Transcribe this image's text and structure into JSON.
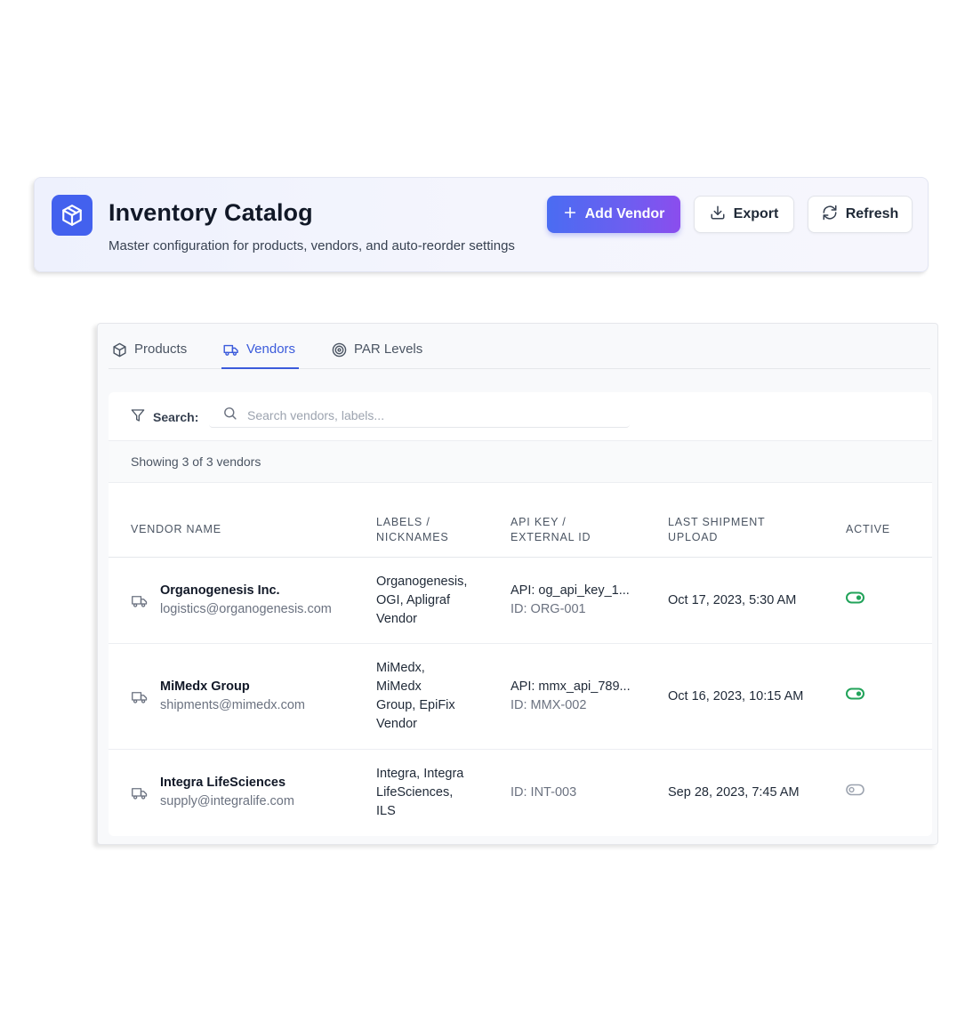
{
  "header": {
    "title": "Inventory Catalog",
    "subtitle": "Master configuration for products, vendors, and auto-reorder settings",
    "buttons": {
      "add_vendor": "Add Vendor",
      "export": "Export",
      "refresh": "Refresh"
    }
  },
  "tabs": [
    {
      "label": "Products",
      "icon": "box-icon",
      "active": false
    },
    {
      "label": "Vendors",
      "icon": "truck-icon",
      "active": true
    },
    {
      "label": "PAR Levels",
      "icon": "target-icon",
      "active": false
    }
  ],
  "filter": {
    "label": "Search:",
    "placeholder": "Search vendors, labels...",
    "value": ""
  },
  "summary": "Showing 3 of 3 vendors",
  "table": {
    "columns": {
      "vendor_name": "VENDOR NAME",
      "labels_1": "LABELS /",
      "labels_2": "NICKNAMES",
      "api_1": "API KEY /",
      "api_2": "EXTERNAL ID",
      "shipment_1": "LAST SHIPMENT",
      "shipment_2": "UPLOAD",
      "active": "ACTIVE"
    },
    "rows": [
      {
        "name": "Organogenesis Inc.",
        "email": "logistics@organogenesis.com",
        "labels": [
          "Organogenesis,",
          "OGI, Apligraf",
          "Vendor"
        ],
        "api_key": "API: og_api_key_1...",
        "external_id": "ID: ORG-001",
        "last_upload": "Oct 17, 2023, 5:30 AM",
        "active": true
      },
      {
        "name": "MiMedx Group",
        "email": "shipments@mimedx.com",
        "labels": [
          "MiMedx,",
          "MiMedx",
          "Group, EpiFix",
          "Vendor"
        ],
        "api_key": "API: mmx_api_789...",
        "external_id": "ID: MMX-002",
        "last_upload": "Oct 16, 2023, 10:15 AM",
        "active": true
      },
      {
        "name": "Integra LifeSciences",
        "email": "supply@integralife.com",
        "labels": [
          "Integra, Integra",
          "LifeSciences,",
          "ILS"
        ],
        "api_key": "",
        "external_id": "ID: INT-003",
        "last_upload": "Sep 28, 2023, 7:45 AM",
        "active": false
      }
    ]
  },
  "colors": {
    "brand": "#4361ee",
    "tab_active": "#3b5bdb",
    "toggle_on": "#22a35a",
    "toggle_off": "#9ca3af"
  }
}
